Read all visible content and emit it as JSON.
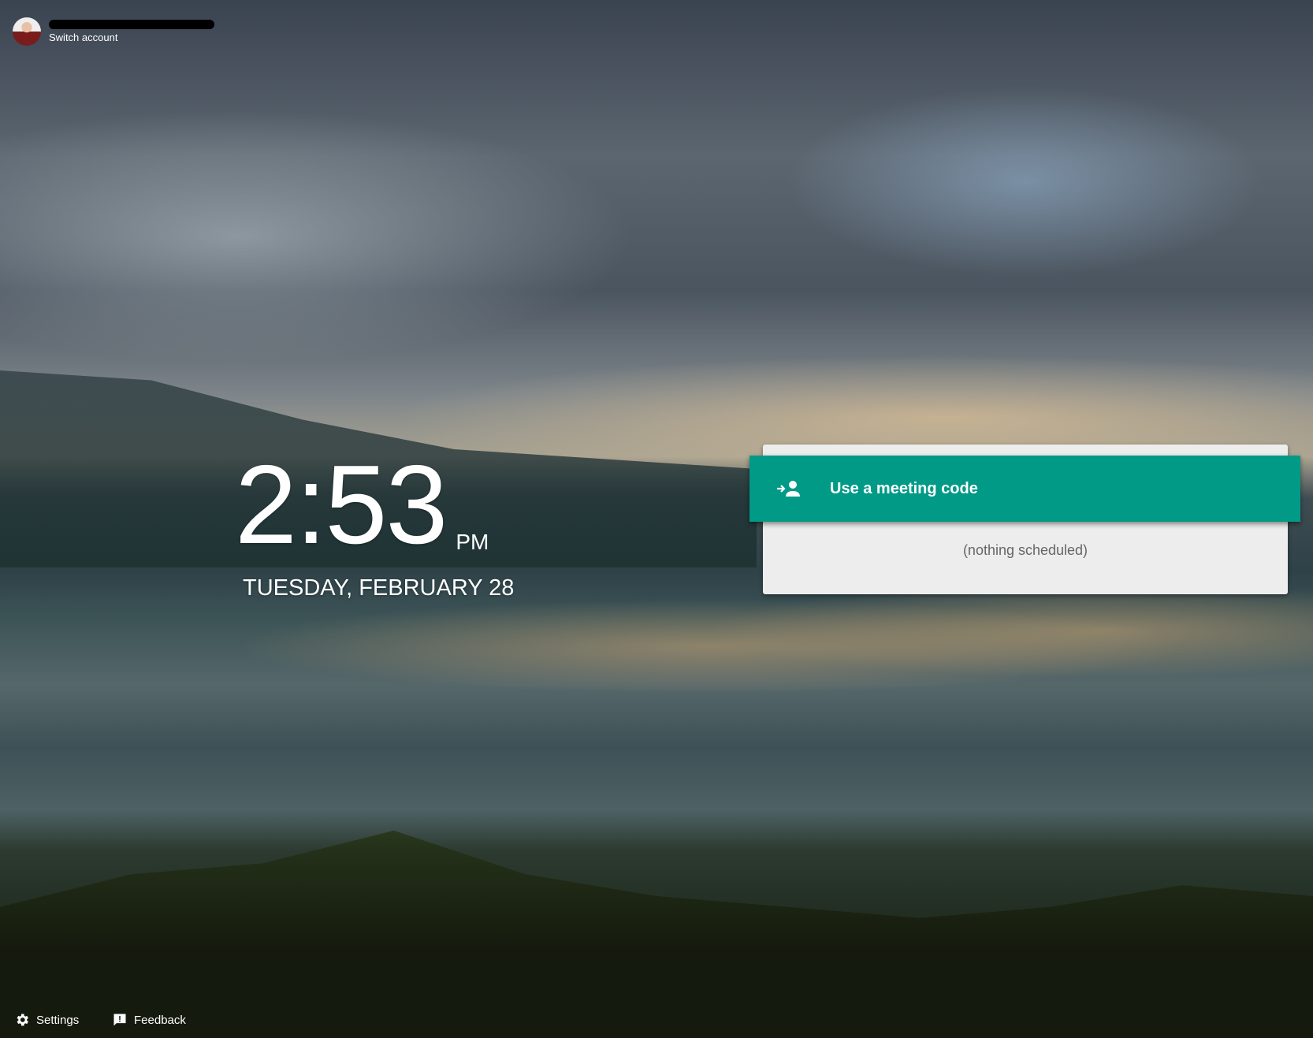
{
  "account": {
    "switch_label": "Switch account"
  },
  "clock": {
    "time": "2:53",
    "ampm": "PM",
    "date": "TUESDAY, FEBRUARY 28"
  },
  "meeting": {
    "button_label": "Use a meeting code",
    "empty_text": "(nothing scheduled)",
    "accent": "#009a87"
  },
  "footer": {
    "settings_label": "Settings",
    "feedback_label": "Feedback"
  }
}
